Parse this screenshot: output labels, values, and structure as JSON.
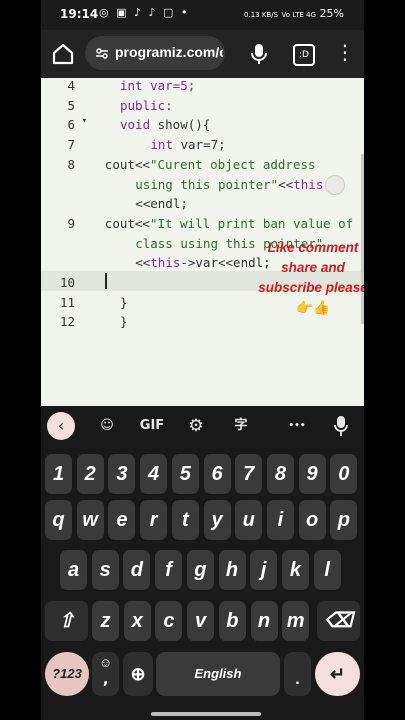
{
  "status_bar": {
    "time": "19:14",
    "icons_left": "◎ ▣ ♪ ♪ ▢ •",
    "speed": "0.13 KB/S",
    "network": "Vo LTE 4G",
    "battery": "25%"
  },
  "browser": {
    "url": "programiz.com/c"
  },
  "editor": {
    "lines": [
      {
        "num": "4",
        "arrow": "",
        "indent": 5,
        "parts": [
          {
            "t": "int var=5;",
            "c": "kw_mix"
          }
        ]
      },
      {
        "num": "5",
        "arrow": "",
        "indent": 5,
        "parts": [
          {
            "t": "public:",
            "c": "kw"
          }
        ]
      },
      {
        "num": "6",
        "arrow": "▾",
        "indent": 5,
        "parts": [
          {
            "t": "void",
            "c": "kw"
          },
          {
            "t": " show(){",
            "c": "plain"
          }
        ]
      },
      {
        "num": "7",
        "arrow": "",
        "indent": 9,
        "parts": [
          {
            "t": "int",
            "c": "kw"
          },
          {
            "t": " var=7;",
            "c": "plain"
          }
        ]
      },
      {
        "num": "8",
        "arrow": "",
        "indent": 3,
        "parts": [
          {
            "t": "cout<<",
            "c": "plain"
          },
          {
            "t": "\"Curent object address",
            "c": "str"
          }
        ]
      },
      {
        "num": "",
        "arrow": "",
        "indent": 7,
        "parts": [
          {
            "t": "using this pointer\"",
            "c": "str"
          },
          {
            "t": "<<",
            "c": "plain"
          },
          {
            "t": "this",
            "c": "kw"
          }
        ]
      },
      {
        "num": "",
        "arrow": "",
        "indent": 7,
        "parts": [
          {
            "t": "<<endl;",
            "c": "plain"
          }
        ]
      },
      {
        "num": "9",
        "arrow": "",
        "indent": 3,
        "parts": [
          {
            "t": "cout<<",
            "c": "plain"
          },
          {
            "t": "\"It will print ban value of",
            "c": "str"
          }
        ]
      },
      {
        "num": "",
        "arrow": "",
        "indent": 7,
        "parts": [
          {
            "t": "class using this pointer\"",
            "c": "str"
          }
        ]
      },
      {
        "num": "",
        "arrow": "",
        "indent": 7,
        "parts": [
          {
            "t": "<<",
            "c": "plain"
          },
          {
            "t": "this",
            "c": "kw"
          },
          {
            "t": "->var<<endl;",
            "c": "plain"
          }
        ]
      },
      {
        "num": "10",
        "arrow": "",
        "indent": 3,
        "parts": [
          {
            "t": "",
            "c": "plain"
          }
        ]
      },
      {
        "num": "11",
        "arrow": "",
        "indent": 5,
        "parts": [
          {
            "t": "}",
            "c": "plain"
          }
        ]
      },
      {
        "num": "12",
        "arrow": "",
        "indent": 5,
        "parts": [
          {
            "t": "}",
            "c": "plain"
          }
        ]
      }
    ]
  },
  "overlay": {
    "line1": "Like comment",
    "line2": "share and",
    "line3": "subscribe please",
    "emoji": "👉👍"
  },
  "keyboard": {
    "toolbar": {
      "back": "‹",
      "sticker": "☺",
      "gif": "GIF",
      "settings": "⚙",
      "translate": "字",
      "more": "•••",
      "mic": "▮"
    },
    "row_numbers": [
      "1",
      "2",
      "3",
      "4",
      "5",
      "6",
      "7",
      "8",
      "9",
      "0"
    ],
    "row_top": [
      "q",
      "w",
      "e",
      "r",
      "t",
      "y",
      "u",
      "i",
      "o",
      "p"
    ],
    "row_mid": [
      "a",
      "s",
      "d",
      "f",
      "g",
      "h",
      "j",
      "k",
      "l"
    ],
    "row_bottom": [
      "z",
      "x",
      "c",
      "v",
      "b",
      "n",
      "m"
    ],
    "shift": "⇧",
    "backspace": "⌫",
    "symbols": "?123",
    "emoji_key": "☺",
    "comma": ",",
    "globe": "⊕",
    "space": "English",
    "period": ".",
    "enter": "↵"
  }
}
